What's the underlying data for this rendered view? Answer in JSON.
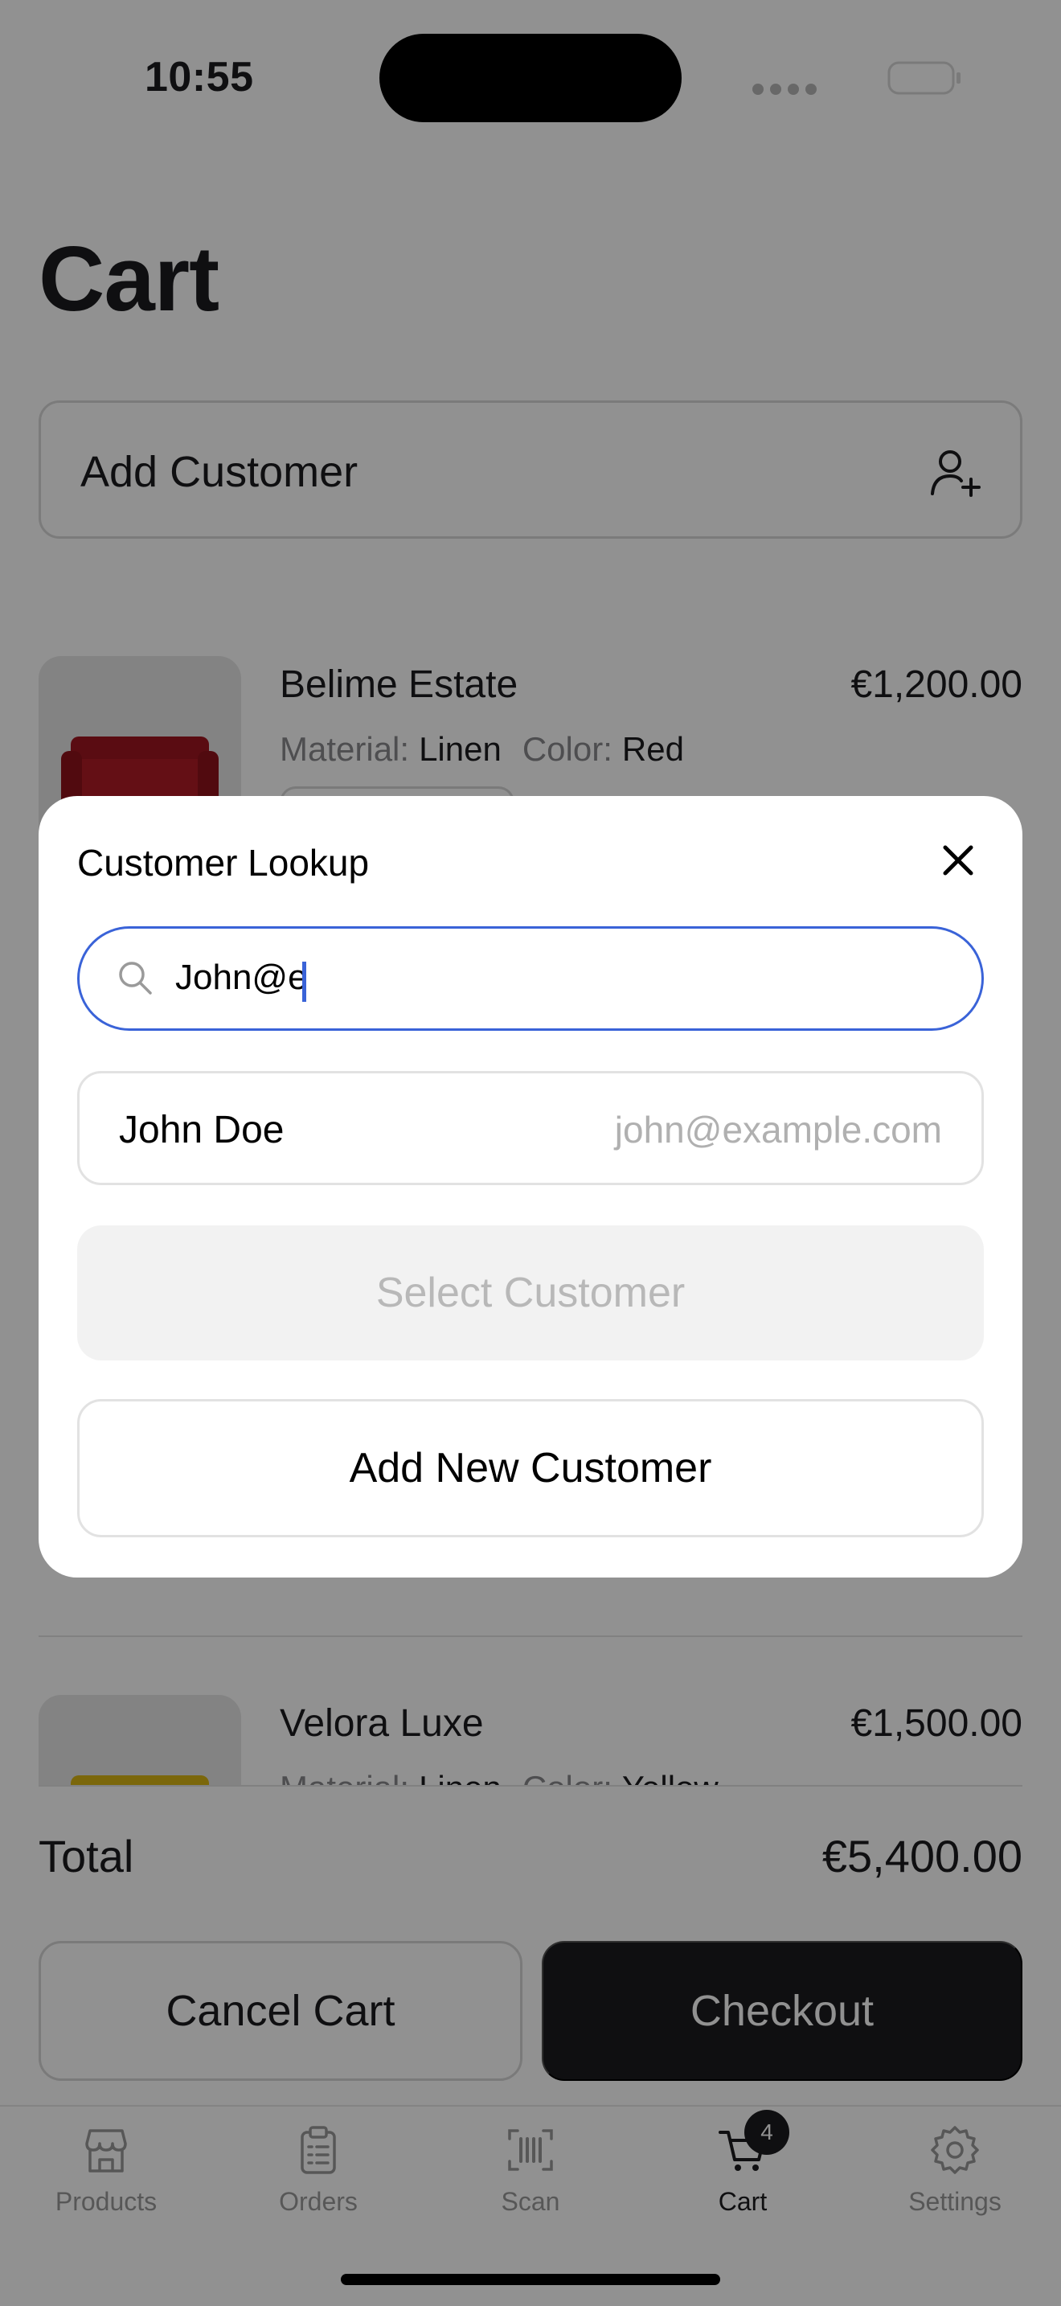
{
  "status_bar": {
    "time": "10:55"
  },
  "page": {
    "title": "Cart"
  },
  "add_customer": {
    "label": "Add Customer"
  },
  "cart_items": [
    {
      "name": "Belime Estate",
      "price": "€1,200.00",
      "material_key": "Material:",
      "material": "Linen",
      "color_key": "Color:",
      "color": "Red",
      "swatch": "#a3141d"
    },
    {
      "name": "Velora Luxe",
      "price": "€1,500.00",
      "material_key": "Material:",
      "material": "Linen",
      "color_key": "Color:",
      "color": "Yellow",
      "swatch": "#e8c21c"
    }
  ],
  "summary": {
    "total_label": "Total",
    "total_value": "€5,400.00"
  },
  "actions": {
    "cancel": "Cancel Cart",
    "checkout": "Checkout"
  },
  "tab_bar": {
    "items": [
      {
        "label": "Products",
        "icon": "storefront-icon"
      },
      {
        "label": "Orders",
        "icon": "clipboard-icon"
      },
      {
        "label": "Scan",
        "icon": "barcode-scan-icon"
      },
      {
        "label": "Cart",
        "icon": "cart-icon",
        "active": true,
        "badge": "4"
      },
      {
        "label": "Settings",
        "icon": "gear-icon"
      }
    ]
  },
  "modal": {
    "title": "Customer Lookup",
    "search": {
      "value": "John@e",
      "icon": "search-icon"
    },
    "results": [
      {
        "name": "John Doe",
        "email": "john@example.com"
      }
    ],
    "select_label": "Select Customer",
    "add_new_label": "Add New Customer"
  },
  "colors": {
    "accent": "#3a63d8",
    "dark": "#1c1c1e",
    "disabled_text": "#b8b8b8"
  }
}
